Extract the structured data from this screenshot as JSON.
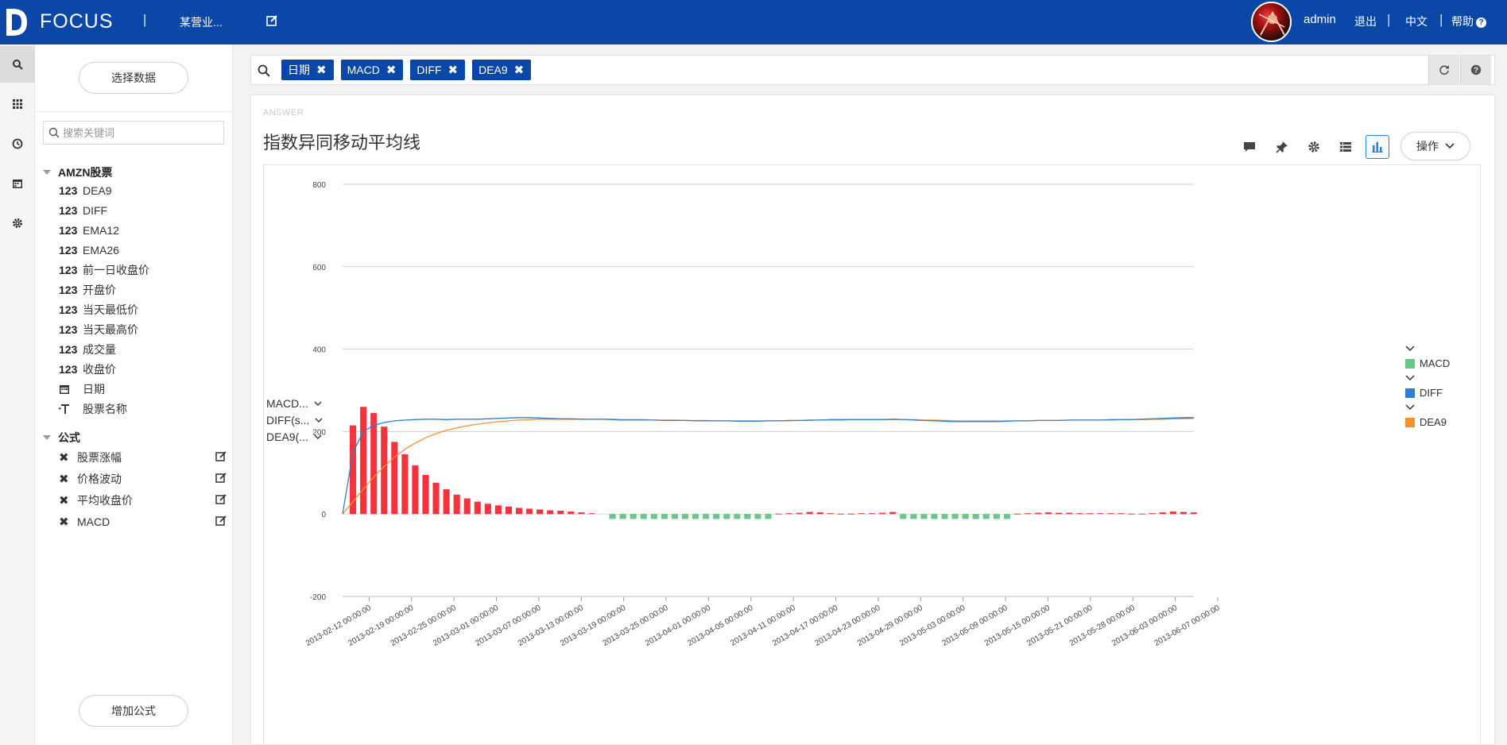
{
  "header": {
    "brand": "FOCUS",
    "project": "某营业...",
    "user": "admin",
    "logout": "退出",
    "language": "中文",
    "help": "帮助",
    "separator": "|"
  },
  "rail": {
    "icons": [
      "search-icon",
      "apps-icon",
      "history-icon",
      "calendar-icon",
      "settings-icon"
    ]
  },
  "left_panel": {
    "select_data_label": "选择数据",
    "search_placeholder": "搜索关键词",
    "table_group": "AMZN股票",
    "fields": [
      {
        "type": "123",
        "name": "DEA9"
      },
      {
        "type": "123",
        "name": "DIFF"
      },
      {
        "type": "123",
        "name": "EMA12"
      },
      {
        "type": "123",
        "name": "EMA26"
      },
      {
        "type": "123",
        "name": "前一日收盘价"
      },
      {
        "type": "123",
        "name": "开盘价"
      },
      {
        "type": "123",
        "name": "当天最低价"
      },
      {
        "type": "123",
        "name": "当天最高价"
      },
      {
        "type": "123",
        "name": "成交量"
      },
      {
        "type": "123",
        "name": "收盘价"
      },
      {
        "type": "date",
        "name": "日期"
      },
      {
        "type": "text",
        "name": "股票名称"
      }
    ],
    "formula_group": "公式",
    "formulas": [
      "股票涨幅",
      "价格波动",
      "平均收盘价",
      "MACD"
    ],
    "add_formula_label": "增加公式"
  },
  "query": {
    "chips": [
      "日期",
      "MACD",
      "DIFF",
      "DEA9"
    ]
  },
  "answer": {
    "label": "ANSWER",
    "title": "指数异同移动平均线",
    "ops_label": "操作"
  },
  "measure_selectors": [
    "MACD...",
    "DIFF(s...",
    "DEA9(..."
  ],
  "colors": {
    "brand": "#0a47a6",
    "macd_up": "#f4333c",
    "macd_down": "#66c987",
    "diff": "#2f7fd0",
    "dea9": "#f5922f"
  },
  "chart_data": {
    "type": "bar",
    "ylim": [
      -200,
      800
    ],
    "yticks": [
      800,
      600,
      400,
      200,
      0,
      -200
    ],
    "x_tick_labels": [
      "2013-02-12 00:00:00",
      "2013-02-19 00:00:00",
      "2013-02-25 00:00:00",
      "2013-03-01 00:00:00",
      "2013-03-07 00:00:00",
      "2013-03-13 00:00:00",
      "2013-03-19 00:00:00",
      "2013-03-25 00:00:00",
      "2013-04-01 00:00:00",
      "2013-04-05 00:00:00",
      "2013-04-11 00:00:00",
      "2013-04-17 00:00:00",
      "2013-04-23 00:00:00",
      "2013-04-29 00:00:00",
      "2013-05-03 00:00:00",
      "2013-05-09 00:00:00",
      "2013-05-15 00:00:00",
      "2013-05-21 00:00:00",
      "2013-05-28 00:00:00",
      "2013-06-03 00:00:00",
      "2013-06-07 00:00:00"
    ],
    "series": [
      {
        "name": "MACD",
        "type": "bar",
        "values": [
          0,
          215,
          260,
          245,
          212,
          175,
          145,
          118,
          95,
          76,
          60,
          47,
          38,
          30,
          25,
          21,
          18,
          15,
          13,
          11,
          9,
          8,
          6,
          4,
          2,
          0,
          -12,
          -12,
          -12,
          -12,
          -12,
          -12,
          -12,
          -12,
          -12,
          -12,
          -12,
          -12,
          -12,
          -12,
          -12,
          -12,
          1,
          2,
          3,
          5,
          4,
          2,
          1,
          1,
          2,
          2,
          3,
          5,
          -12,
          -12,
          -12,
          -12,
          -12,
          -12,
          -12,
          -12,
          -12,
          -12,
          -12,
          1,
          2,
          3,
          4,
          3,
          3,
          2,
          2,
          2,
          2,
          2,
          1,
          1,
          2,
          4,
          6,
          5,
          4
        ]
      },
      {
        "name": "DIFF",
        "type": "line",
        "values": [
          0,
          150,
          200,
          215,
          222,
          226,
          228,
          229,
          230,
          230,
          229,
          230,
          230,
          230,
          231,
          232,
          233,
          234,
          234,
          233,
          232,
          231,
          231,
          230,
          230,
          230,
          229,
          228,
          228,
          228,
          228,
          227,
          227,
          227,
          226,
          226,
          226,
          226,
          225,
          225,
          225,
          226,
          226,
          227,
          227,
          228,
          228,
          229,
          229,
          229,
          229,
          229,
          229,
          230,
          229,
          228,
          227,
          226,
          225,
          224,
          224,
          224,
          224,
          224,
          225,
          226,
          226,
          227,
          227,
          227,
          228,
          228,
          228,
          228,
          229,
          229,
          229,
          230,
          231,
          232,
          233,
          234,
          234
        ]
      },
      {
        "name": "DEA9",
        "type": "line",
        "values": [
          0,
          30,
          60,
          90,
          115,
          138,
          157,
          172,
          185,
          195,
          203,
          209,
          214,
          218,
          221,
          224,
          226,
          228,
          229,
          230,
          230,
          230,
          230,
          230,
          230,
          230,
          230,
          229,
          229,
          229,
          228,
          228,
          228,
          227,
          227,
          227,
          226,
          226,
          226,
          226,
          226,
          226,
          226,
          226,
          227,
          227,
          228,
          228,
          228,
          229,
          229,
          229,
          229,
          229,
          229,
          229,
          228,
          228,
          227,
          226,
          226,
          226,
          226,
          226,
          226,
          226,
          226,
          227,
          227,
          227,
          228,
          228,
          228,
          228,
          228,
          229,
          229,
          229,
          230,
          230,
          231,
          231,
          232
        ]
      }
    ]
  }
}
